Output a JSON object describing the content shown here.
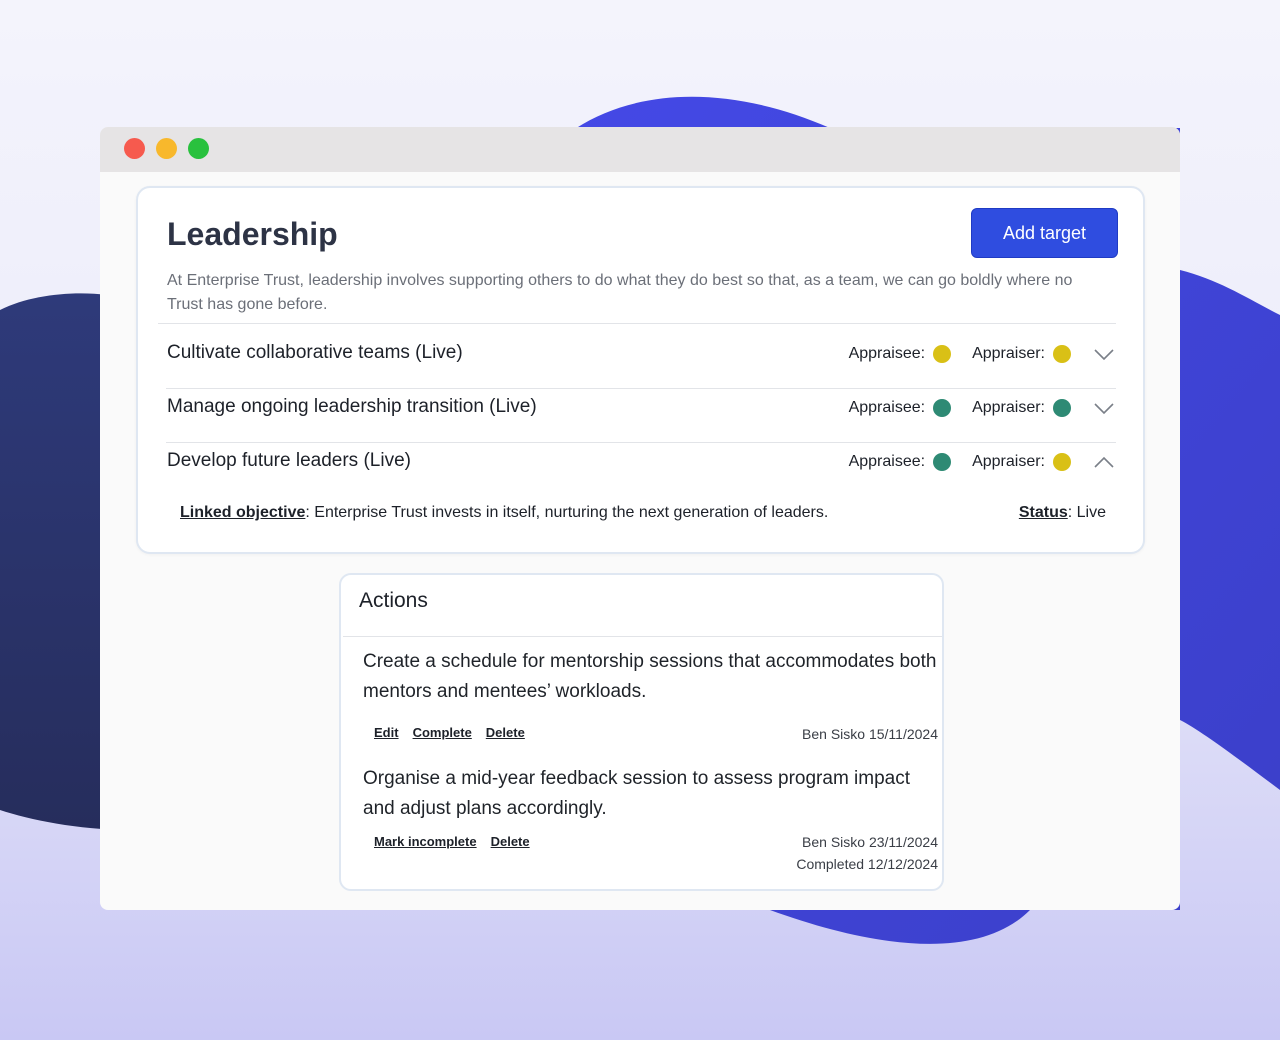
{
  "window": {
    "controls": [
      "close",
      "minimize",
      "maximize"
    ],
    "colors": {
      "close": "#f65a4e",
      "minimize": "#f8b82c",
      "maximize": "#29c13e"
    }
  },
  "card": {
    "title": "Leadership",
    "add_button": "Add target",
    "description": "At Enterprise Trust, leadership involves supporting others to do what they do best so that, as a team, we can go boldly where no Trust has gone before."
  },
  "targets": [
    {
      "title": "Cultivate collaborative teams (Live)",
      "appraisee_label": "Appraisee:",
      "appraisee_color": "#d9c016",
      "appraiser_label": "Appraiser:",
      "appraiser_color": "#d9c016",
      "expanded": false,
      "chevron": "chevron-down-icon"
    },
    {
      "title": "Manage ongoing leadership transition (Live)",
      "appraisee_label": "Appraisee:",
      "appraisee_color": "#2e8a74",
      "appraiser_label": "Appraiser:",
      "appraiser_color": "#2e8a74",
      "expanded": false,
      "chevron": "chevron-down-icon"
    },
    {
      "title": "Develop future leaders (Live)",
      "appraisee_label": "Appraisee:",
      "appraisee_color": "#2e8a74",
      "appraiser_label": "Appraiser:",
      "appraiser_color": "#d9c016",
      "expanded": true,
      "chevron": "chevron-up-icon"
    }
  ],
  "expanded_target": {
    "linked_label": "Linked objective",
    "linked_value": ": Enterprise Trust invests in itself, nurturing the next generation of leaders.",
    "status_label": "Status",
    "status_value": ": Live"
  },
  "actions": {
    "title": "Actions",
    "items": [
      {
        "text": "Create a schedule for mentorship sessions that accommodates both mentors and mentees’ workloads.",
        "links": [
          "Edit",
          "Complete",
          "Delete"
        ],
        "meta": "Ben Sisko 15/11/2024",
        "completed": ""
      },
      {
        "text": "Organise a mid-year feedback session to assess program impact and adjust plans accordingly.",
        "links": [
          "Mark incomplete",
          "Delete"
        ],
        "meta": "Ben Sisko 23/11/2024",
        "completed": "Completed 12/12/2024"
      }
    ]
  }
}
